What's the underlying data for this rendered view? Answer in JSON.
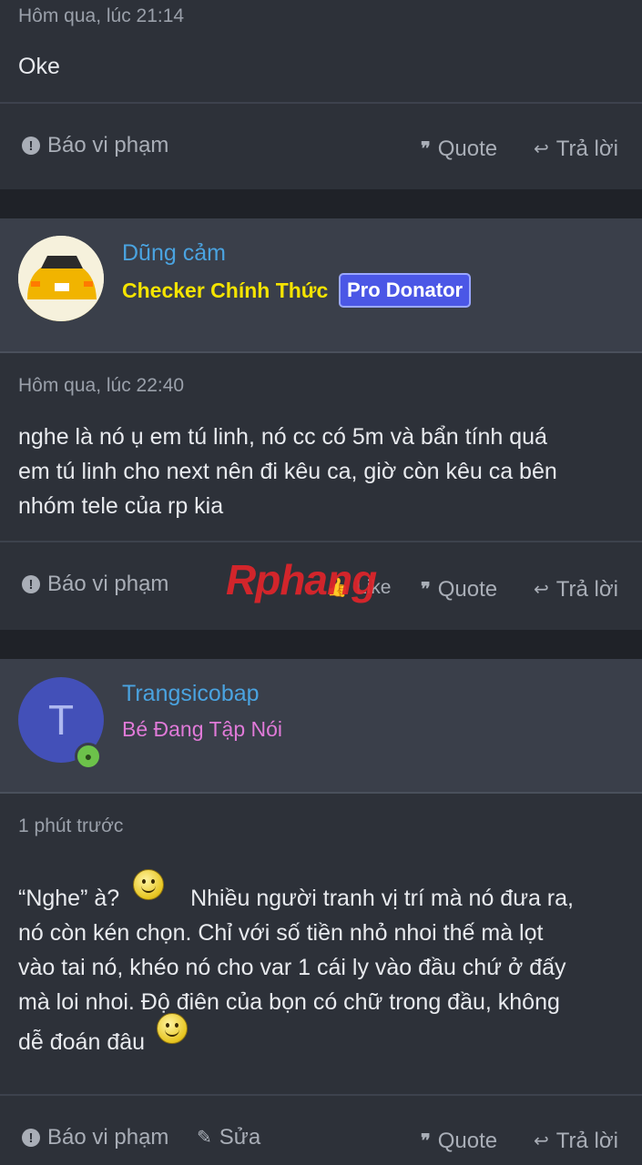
{
  "post1": {
    "date": "Hôm qua, lúc 21:14",
    "body": "Oke",
    "actions": {
      "report": "Báo vi phạm",
      "quote": "Quote",
      "reply": "Trả lời"
    }
  },
  "post2": {
    "username": "Dũng cảm",
    "user_title": "Checker Chính Thức",
    "badge": "Pro Donator",
    "date": "Hôm qua, lúc 22:40",
    "body_lines": [
      "nghe là nó ụ em tú linh, nó cc có 5m và bẩn tính quá",
      "em tú linh cho next nên đi kêu ca, giờ còn kêu ca bên",
      "nhóm tele của rp kia"
    ],
    "watermark": "Rphang",
    "actions": {
      "report": "Báo vi phạm",
      "like": "Like",
      "quote": "Quote",
      "reply": "Trả lời"
    }
  },
  "post3": {
    "avatar_letter": "T",
    "username": "Trangsicobap",
    "user_title": "Bé Đang Tập Nói",
    "date": "1 phút trước",
    "body_line1_a": "“Nghe” à?",
    "body_line1_b": "Nhiều người tranh vị trí mà nó đưa ra,",
    "body_lines": [
      "nó còn kén chọn. Chỉ với số tiền nhỏ nhoi thế mà lọt",
      "vào tai nó, khéo nó cho var 1 cái ly vào đầu chứ ở đấy",
      "mà loi nhoi. Độ điên của bọn có chữ trong đầu, không"
    ],
    "body_last": "dễ đoán đâu",
    "actions": {
      "report": "Báo vi phạm",
      "edit": "Sửa",
      "quote": "Quote",
      "reply": "Trả lời"
    }
  },
  "colors": {
    "username": "#4aa3e0",
    "checker": "#f5e400",
    "beginner": "#e07ad8",
    "badge": "#4b57e6"
  }
}
